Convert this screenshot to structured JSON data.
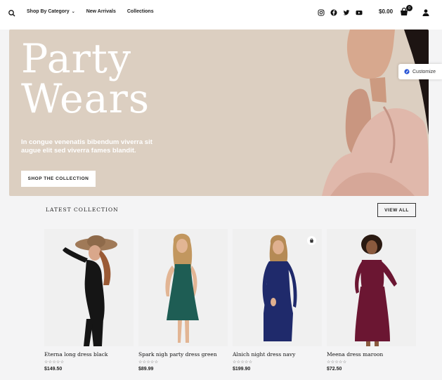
{
  "header": {
    "nav": [
      {
        "label": "Shop By Category",
        "has_dropdown": true
      },
      {
        "label": "New Arrivals"
      },
      {
        "label": "Collections"
      }
    ],
    "social_icons": [
      "instagram-icon",
      "facebook-icon",
      "twitter-icon",
      "youtube-icon"
    ],
    "cart_total": "$0.00",
    "cart_count": "0"
  },
  "hero": {
    "title_line1": "Party",
    "title_line2": "Wears",
    "subtitle": "In congue venenatis bibendum viverra sit augue elit sed viverra fames blandit.",
    "button_label": "SHOP THE COLLECTION",
    "background_color": "#dccfc1"
  },
  "customize": {
    "label": "Customize"
  },
  "collection": {
    "title": "LATEST COLLECTION",
    "view_all_label": "VIEW ALL",
    "products": [
      {
        "name": "Eterna long dress black",
        "stars": "☆☆☆☆☆",
        "price": "$149.50",
        "dress_color": "#151515"
      },
      {
        "name": "Spark nigh party dress green",
        "stars": "☆☆☆☆☆",
        "price": "$89.99",
        "dress_color": "#1e5d54"
      },
      {
        "name": "Alnich night dress navy",
        "stars": "☆☆☆☆☆",
        "price": "$199.90",
        "dress_color": "#1f2a6b"
      },
      {
        "name": "Meena dress maroon",
        "stars": "☆☆☆☆☆",
        "price": "$72.50",
        "dress_color": "#6b1632"
      }
    ]
  }
}
